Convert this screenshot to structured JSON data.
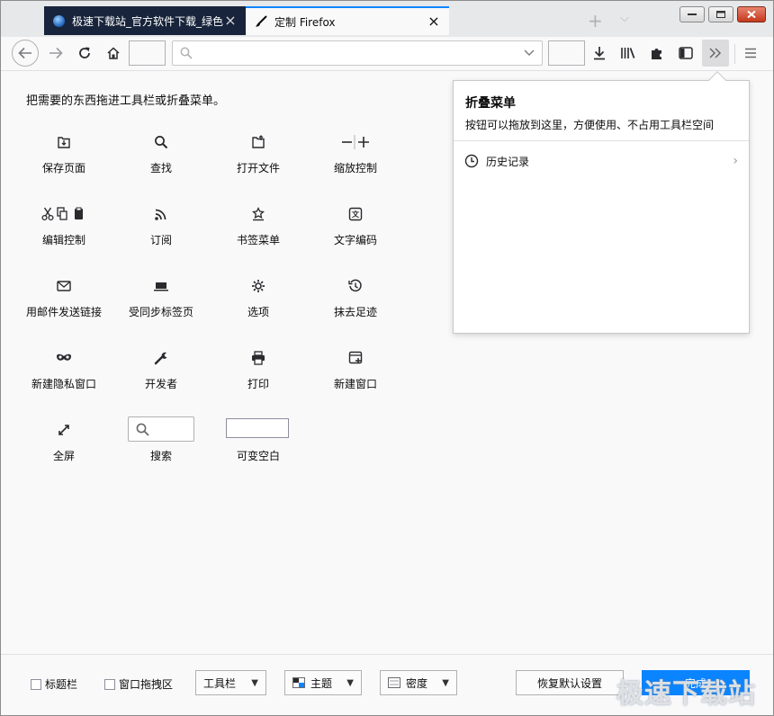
{
  "tabs": [
    {
      "title": "极速下载站_官方软件下载_绿色"
    },
    {
      "title": "定制 Firefox"
    }
  ],
  "navbar": {
    "url_value": "",
    "url_placeholder": ""
  },
  "customize": {
    "intro": "把需要的东西拖进工具栏或折叠菜单。",
    "palette": [
      {
        "label": "保存页面",
        "icon": "save-page-icon"
      },
      {
        "label": "查找",
        "icon": "search-icon"
      },
      {
        "label": "打开文件",
        "icon": "open-file-icon"
      },
      {
        "label": "缩放控制",
        "icon": "zoom-controls-icon"
      },
      {
        "label": "编辑控制",
        "icon": "edit-controls-icon"
      },
      {
        "label": "订阅",
        "icon": "rss-icon"
      },
      {
        "label": "书签菜单",
        "icon": "bookmark-menu-icon"
      },
      {
        "label": "文字编码",
        "icon": "text-encoding-icon"
      },
      {
        "label": "用邮件发送链接",
        "icon": "email-link-icon"
      },
      {
        "label": "受同步标签页",
        "icon": "synced-tabs-icon"
      },
      {
        "label": "选项",
        "icon": "gear-icon"
      },
      {
        "label": "抹去足迹",
        "icon": "forget-history-icon"
      },
      {
        "label": "新建隐私窗口",
        "icon": "private-window-icon"
      },
      {
        "label": "开发者",
        "icon": "wrench-icon"
      },
      {
        "label": "打印",
        "icon": "print-icon"
      },
      {
        "label": "新建窗口",
        "icon": "new-window-icon"
      },
      {
        "label": "全屏",
        "icon": "fullscreen-icon"
      },
      {
        "label": "搜索",
        "icon": "search-box-icon"
      },
      {
        "label": "可变空白",
        "icon": "flexible-space-icon"
      }
    ]
  },
  "overflow_panel": {
    "title": "折叠菜单",
    "description": "按钮可以拖放到这里，方便使用、不占用工具栏空间",
    "items": [
      {
        "label": "历史记录",
        "icon": "clock-icon"
      }
    ]
  },
  "bottom": {
    "title_bar_label": "标题栏",
    "drag_space_label": "窗口拖拽区",
    "toolbars_label": "工具栏",
    "themes_label": "主题",
    "density_label": "密度",
    "restore_label": "恢复默认设置",
    "done_label": "完成"
  },
  "watermark": "极速下载站",
  "colors": {
    "accent": "#0a84ff",
    "inactive_tab": "#17243b",
    "close_button": "#c4391c"
  }
}
